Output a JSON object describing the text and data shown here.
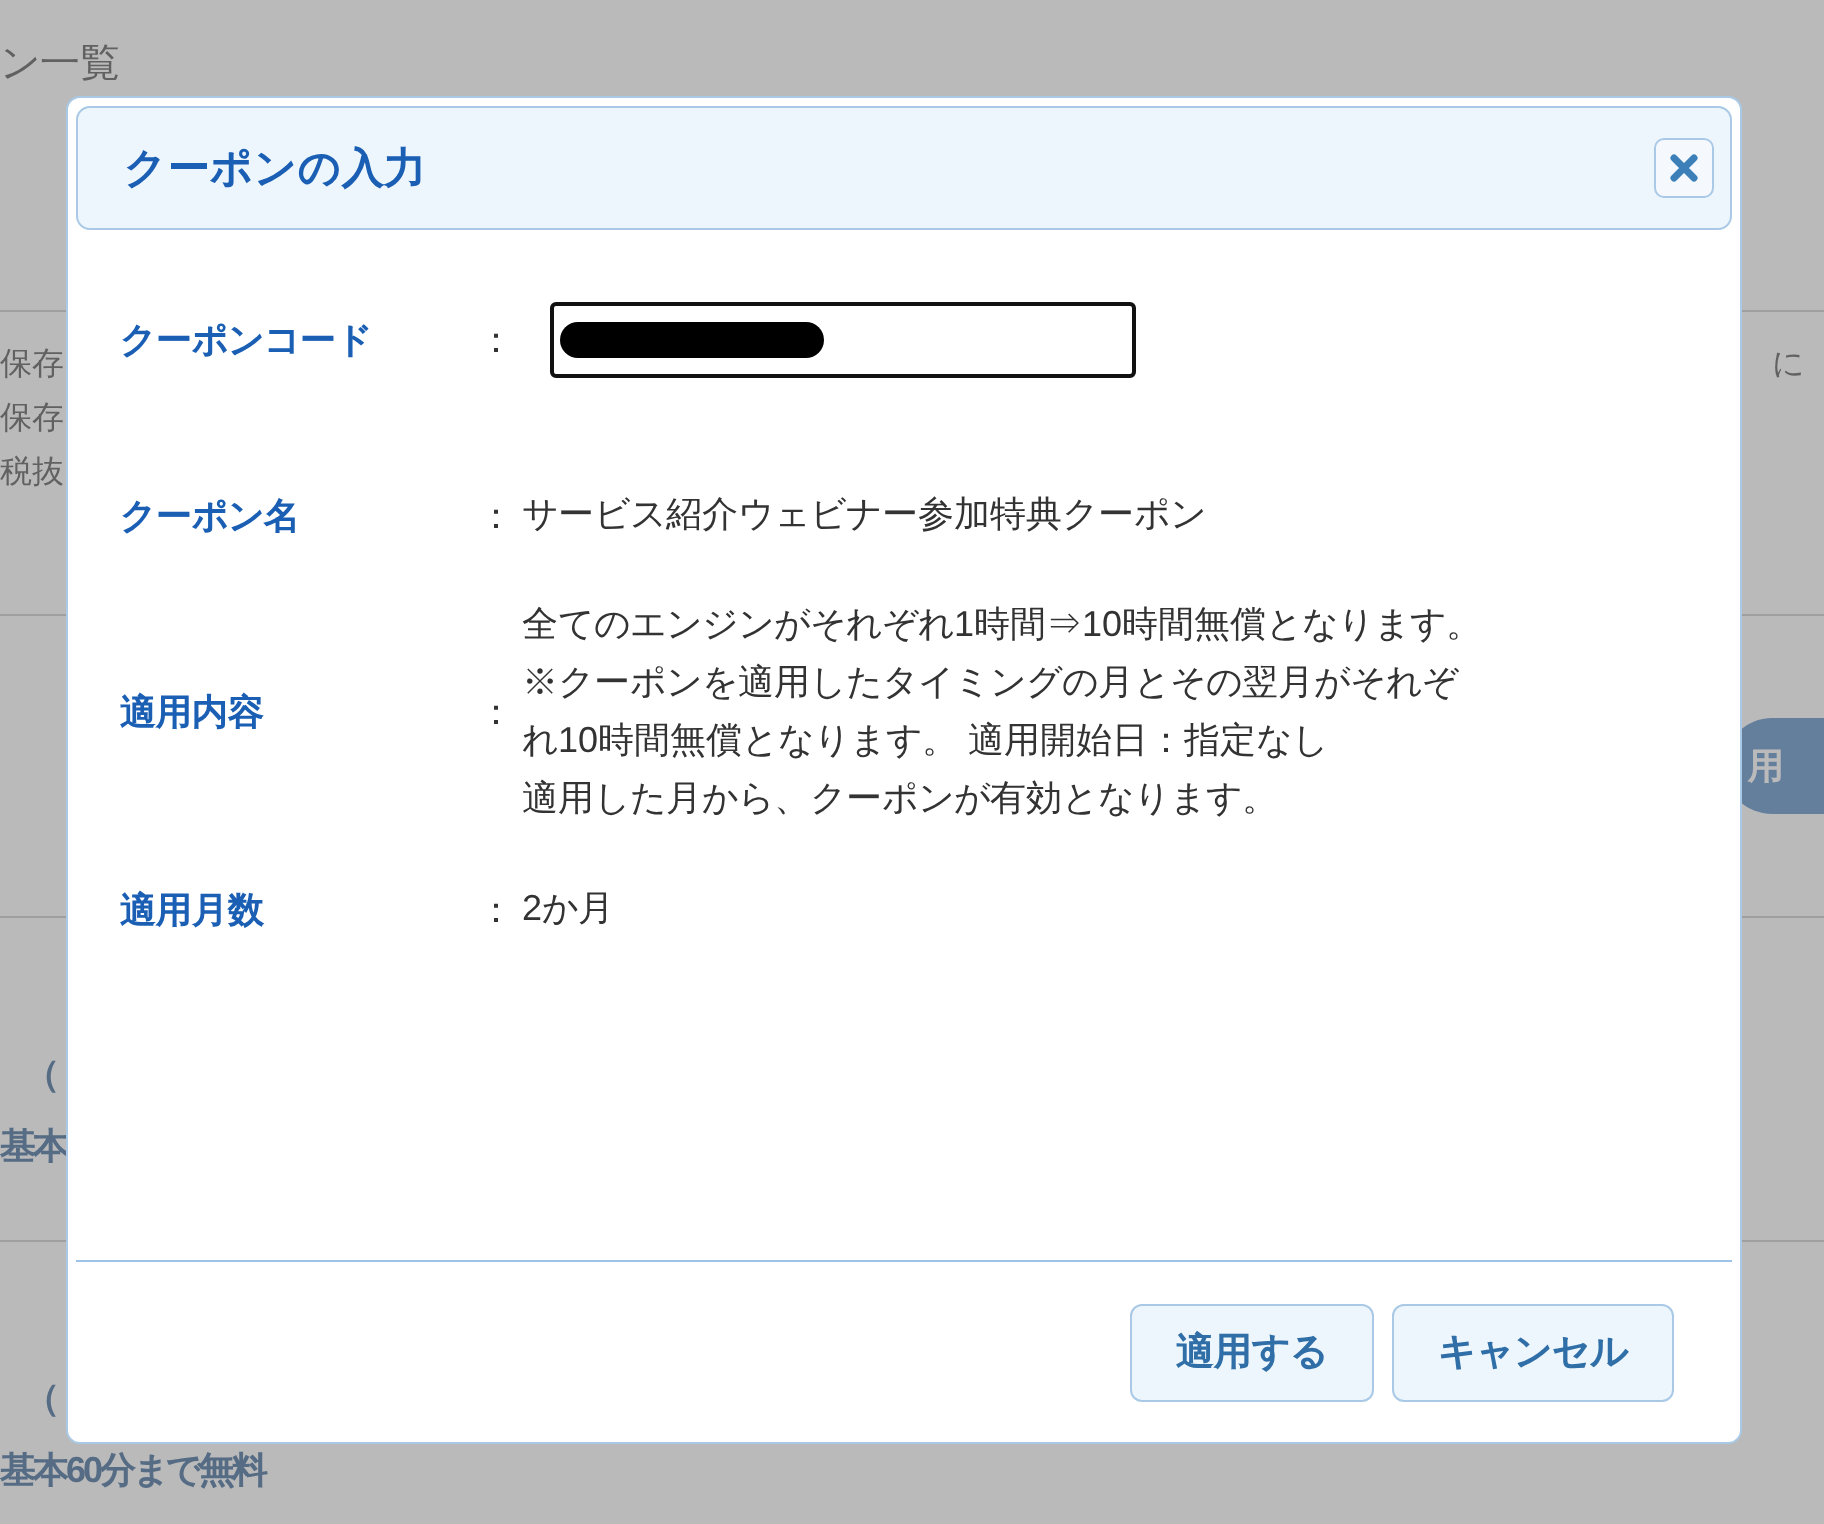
{
  "background_page": {
    "heading": "ン一覧",
    "left_notes": [
      "保存",
      "保存",
      "税抜"
    ],
    "right_note": "に",
    "right_button": "用",
    "row_labels": [
      {
        "paren": "（",
        "text": "基本"
      },
      {
        "paren": "（",
        "text": "基本60分まで無料"
      }
    ]
  },
  "dialog": {
    "title": "クーポンの入力",
    "fields": [
      {
        "kind": "input",
        "label": "クーポンコード",
        "separator": "："
      },
      {
        "kind": "text",
        "label": "クーポン名",
        "separator": "：",
        "lines": [
          "サービス紹介ウェビナー参加特典クーポン"
        ]
      },
      {
        "kind": "text",
        "label": "適用内容",
        "separator": "：",
        "lines": [
          "全てのエンジンがそれぞれ1時間⇒10時間無償となります。",
          "※クーポンを適用したタイミングの月とその翌月がそれぞ",
          "れ10時間無償となります。 適用開始日：指定なし",
          "適用した月から、クーポンが有効となります。"
        ]
      },
      {
        "kind": "text",
        "label": "適用月数",
        "separator": "：",
        "lines": [
          "2か月"
        ]
      }
    ],
    "buttons": [
      "適用する",
      "キャンセル"
    ]
  }
}
